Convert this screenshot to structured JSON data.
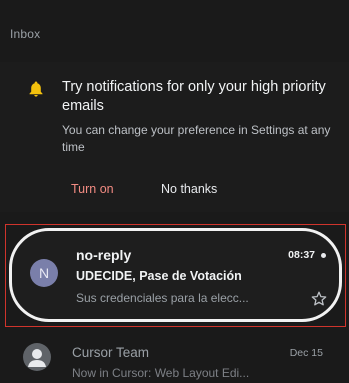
{
  "header": {
    "title": "Inbox"
  },
  "banner": {
    "icon": "bell-icon",
    "icon_color": "#f4c20d",
    "title": "Try notifications for only your high priority emails",
    "body": "You can change your preference in Settings at any time",
    "turn_on_label": "Turn on",
    "no_thanks_label": "No thanks",
    "accent_color": "#f28b82"
  },
  "emails": [
    {
      "avatar_letter": "N",
      "sender": "no-reply",
      "time": "08:37",
      "unread": true,
      "subject": "UDECIDE, Pase de Votación",
      "snippet": "Sus credenciales para la elecc...",
      "starred": false
    },
    {
      "avatar_icon": "person-icon",
      "sender": "Cursor Team",
      "time": "Dec 15",
      "snippet": "Now in Cursor: Web Layout Edi..."
    }
  ],
  "highlight_color": "#d0342c"
}
